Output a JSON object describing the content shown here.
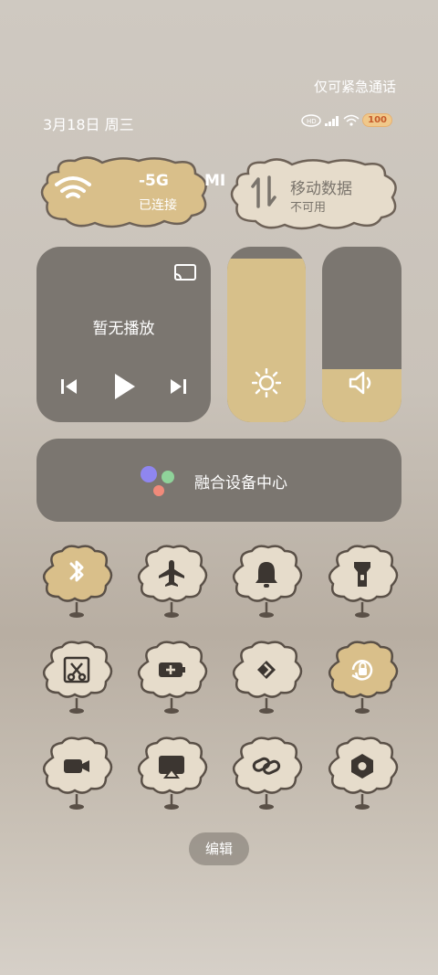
{
  "top_note": "仅可紧急通话",
  "date_label": "3月18日 周三",
  "battery": "100",
  "wifi": {
    "name_a": "-5G",
    "name_b": "MI",
    "state": "已连接"
  },
  "mobile_data": {
    "title": "移动数据",
    "state": "不可用"
  },
  "media": {
    "status": "暂无播放"
  },
  "brightness_level": 0.93,
  "volume_level": 0.3,
  "device_hub": {
    "label": "融合设备中心"
  },
  "toggles": [
    {
      "icon": "bluetooth-icon",
      "active": true
    },
    {
      "icon": "airplane-icon",
      "active": false
    },
    {
      "icon": "bell-icon",
      "active": false
    },
    {
      "icon": "flashlight-icon",
      "active": false
    },
    {
      "icon": "screenshot-icon",
      "active": false
    },
    {
      "icon": "battery-saver-icon",
      "active": false
    },
    {
      "icon": "nearby-share-icon",
      "active": false
    },
    {
      "icon": "rotation-lock-icon",
      "active": true
    },
    {
      "icon": "screen-record-icon",
      "active": false
    },
    {
      "icon": "cast-screen-icon",
      "active": false
    },
    {
      "icon": "link-icon",
      "active": false
    },
    {
      "icon": "settings-hex-icon",
      "active": false
    }
  ],
  "edit_label": "编辑",
  "colors": {
    "active_fill": "#d9bf8a",
    "inactive_fill": "#e6dccb",
    "outline": "#5a5047",
    "panel": "#7b7670"
  }
}
